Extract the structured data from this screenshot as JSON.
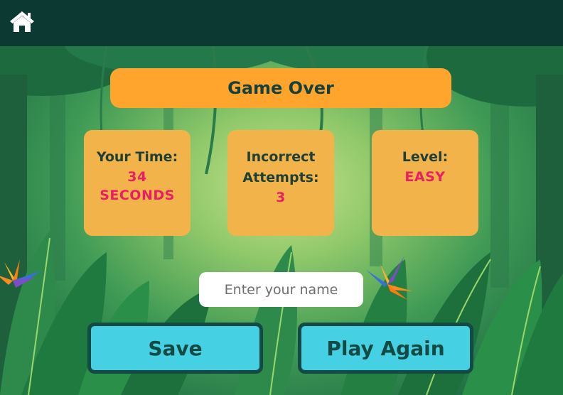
{
  "header": {
    "home_icon": "home-icon"
  },
  "game_over": {
    "title": "Game Over",
    "stats": [
      {
        "label_lines": [
          "Your Time:"
        ],
        "value_lines": [
          "34",
          "SECONDS"
        ]
      },
      {
        "label_lines": [
          "Incorrect",
          "Attempts:"
        ],
        "value_lines": [
          "3"
        ]
      },
      {
        "label_lines": [
          "Level:"
        ],
        "value_lines": [
          "EASY"
        ]
      }
    ],
    "name_input": {
      "placeholder": "Enter your name",
      "value": ""
    },
    "buttons": {
      "save": "Save",
      "play_again": "Play Again"
    }
  },
  "colors": {
    "header_bg": "#0c3a33",
    "title_bar": "#ffa52e",
    "card_bg": "#f2b44a",
    "value_text": "#e81f63",
    "button_bg": "#45d0e3",
    "button_border": "#134a44"
  }
}
